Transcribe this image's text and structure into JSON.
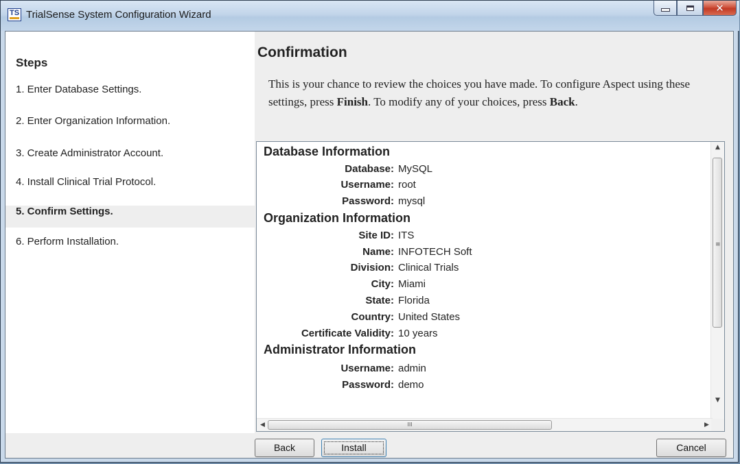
{
  "window": {
    "title": "TrialSense System Configuration Wizard",
    "icon_text": "TS"
  },
  "steps": {
    "heading": "Steps",
    "items": [
      {
        "label": "1. Enter Database Settings.",
        "active": false
      },
      {
        "label": "2. Enter Organization Information.",
        "active": false
      },
      {
        "label": "3. Create Administrator Account.",
        "active": false
      },
      {
        "label": "4. Install Clinical Trial Protocol.",
        "active": false
      },
      {
        "label": "5. Confirm Settings.",
        "active": true
      },
      {
        "label": "6. Perform Installation.",
        "active": false
      }
    ]
  },
  "main": {
    "title": "Confirmation",
    "intro_1": "This is your chance to review the choices you have made. To configure Aspect using these settings, press ",
    "intro_finish": "Finish",
    "intro_2": ". To modify any of your choices, press ",
    "intro_back": "Back",
    "intro_3": "."
  },
  "summary": {
    "database": {
      "heading": "Database Information",
      "rows": [
        {
          "key": "Database:",
          "value": "MySQL"
        },
        {
          "key": "Username:",
          "value": "root"
        },
        {
          "key": "Password:",
          "value": "mysql"
        }
      ]
    },
    "organization": {
      "heading": "Organization Information",
      "rows": [
        {
          "key": "Site ID:",
          "value": "ITS"
        },
        {
          "key": "Name:",
          "value": "INFOTECH Soft"
        },
        {
          "key": "Division:",
          "value": "Clinical Trials"
        },
        {
          "key": "City:",
          "value": "Miami"
        },
        {
          "key": "State:",
          "value": "Florida"
        },
        {
          "key": "Country:",
          "value": "United States"
        },
        {
          "key": "Certificate Validity:",
          "value": "10 years"
        }
      ]
    },
    "administrator": {
      "heading": "Administrator Information",
      "rows": [
        {
          "key": "Username:",
          "value": "admin"
        },
        {
          "key": "Password:",
          "value": "demo"
        }
      ]
    }
  },
  "buttons": {
    "back": "Back",
    "install": "Install",
    "cancel": "Cancel"
  },
  "scrollbar": {
    "up_arrow": "▲",
    "down_arrow": "▼",
    "left_arrow": "◀",
    "right_arrow": "▶",
    "grip_vertical": "≡",
    "grip_horizontal": "III"
  }
}
